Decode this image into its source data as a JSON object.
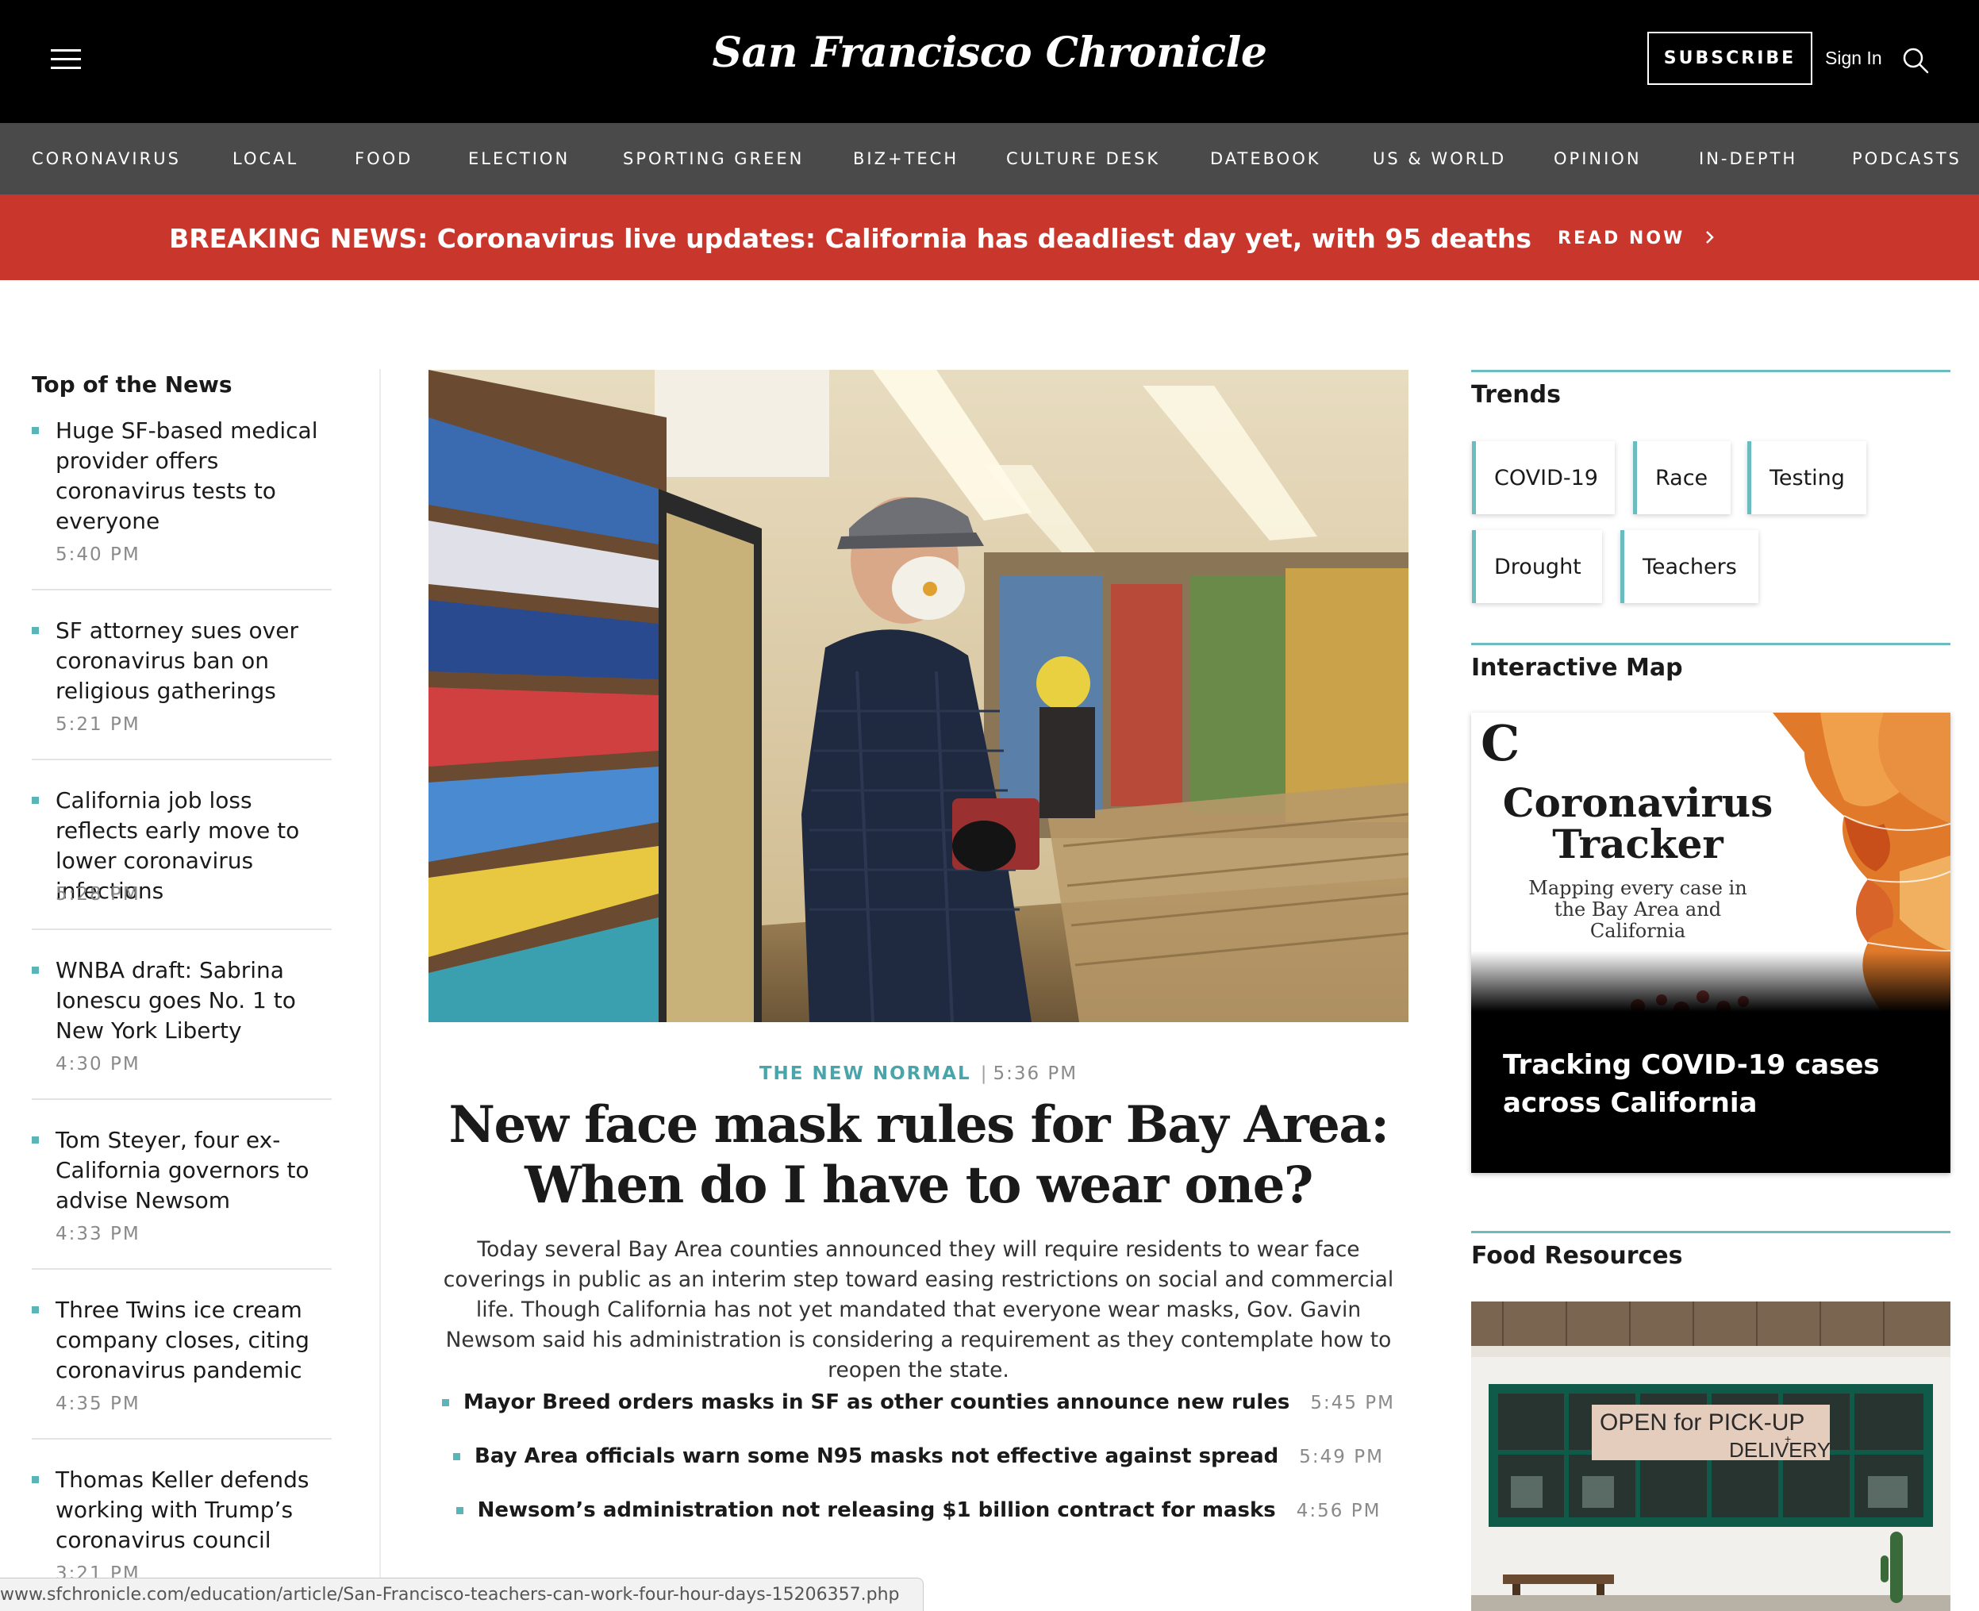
{
  "header": {
    "logo": "San Francisco Chronicle",
    "subscribe_label": "SUBSCRIBE",
    "signin_label": "Sign In"
  },
  "nav": [
    "CORONAVIRUS",
    "LOCAL",
    "FOOD",
    "ELECTION",
    "SPORTING GREEN",
    "BIZ+TECH",
    "CULTURE DESK",
    "DATEBOOK",
    "US & WORLD",
    "OPINION",
    "IN-DEPTH",
    "PODCASTS"
  ],
  "breaking": {
    "text": "BREAKING NEWS: Coronavirus live updates: California has deadliest day yet, with 95 deaths",
    "cta": "READ NOW"
  },
  "top_news": {
    "title": "Top of the News",
    "items": [
      {
        "headline": "Huge SF-based medical provider offers coronavirus tests to everyone",
        "time": "5:40 PM"
      },
      {
        "headline": "SF attorney sues over coronavirus ban on religious gatherings",
        "time": "5:21 PM"
      },
      {
        "headline": "California job loss reflects early move to lower coronavirus infections",
        "time": "5:28 PM"
      },
      {
        "headline": "WNBA draft: Sabrina Ionescu goes No. 1 to New York Liberty",
        "time": "4:30 PM"
      },
      {
        "headline": "Tom Steyer, four ex-California governors to advise Newsom",
        "time": "4:33 PM"
      },
      {
        "headline": "Three Twins ice cream company closes, citing coronavirus pandemic",
        "time": "4:35 PM"
      },
      {
        "headline": "Thomas Keller defends working with Trump’s coronavirus council",
        "time": "3:21 PM"
      }
    ]
  },
  "lead": {
    "kicker": "THE NEW NORMAL",
    "kicker_sep": "|",
    "time": "5:36 PM",
    "headline": "New face mask rules for Bay Area: When do I have to wear one?",
    "summary": "Today several Bay Area counties announced they will require residents to wear face coverings in public as an interim step toward easing restrictions on social and commercial life. Though California has not yet mandated that everyone wear masks, Gov. Gavin Newsom said his administration is considering a requirement as they contemplate how to reopen the state.",
    "related": [
      {
        "headline": "Mayor Breed orders masks in SF as other counties announce new rules",
        "time": "5:45 PM"
      },
      {
        "headline": "Bay Area officials warn some N95 masks not effective against spread",
        "time": "5:49 PM"
      },
      {
        "headline": "Newsom’s administration not releasing $1 billion contract for masks",
        "time": "4:56 PM"
      }
    ]
  },
  "trends": {
    "title": "Trends",
    "items": [
      "COVID-19",
      "Race",
      "Testing",
      "Drought",
      "Teachers"
    ]
  },
  "interactive_map": {
    "title": "Interactive Map",
    "logo": "C",
    "card_title": "Coronavirus Tracker",
    "card_subtitle": "Mapping every case in the Bay Area and California",
    "caption": "Tracking COVID-19 cases across California"
  },
  "food_resources": {
    "title": "Food Resources",
    "sign_line1": "OPEN for PICK-UP",
    "sign_line2": "+",
    "sign_line3": "DELIVERY"
  },
  "status_url": "www.sfchronicle.com/education/article/San-Francisco-teachers-can-work-four-hour-days-15206357.php",
  "colors": {
    "breaking_red": "#c8362c",
    "teal_accent": "#5ab4b8",
    "nav_gray": "#4a4a4a"
  }
}
